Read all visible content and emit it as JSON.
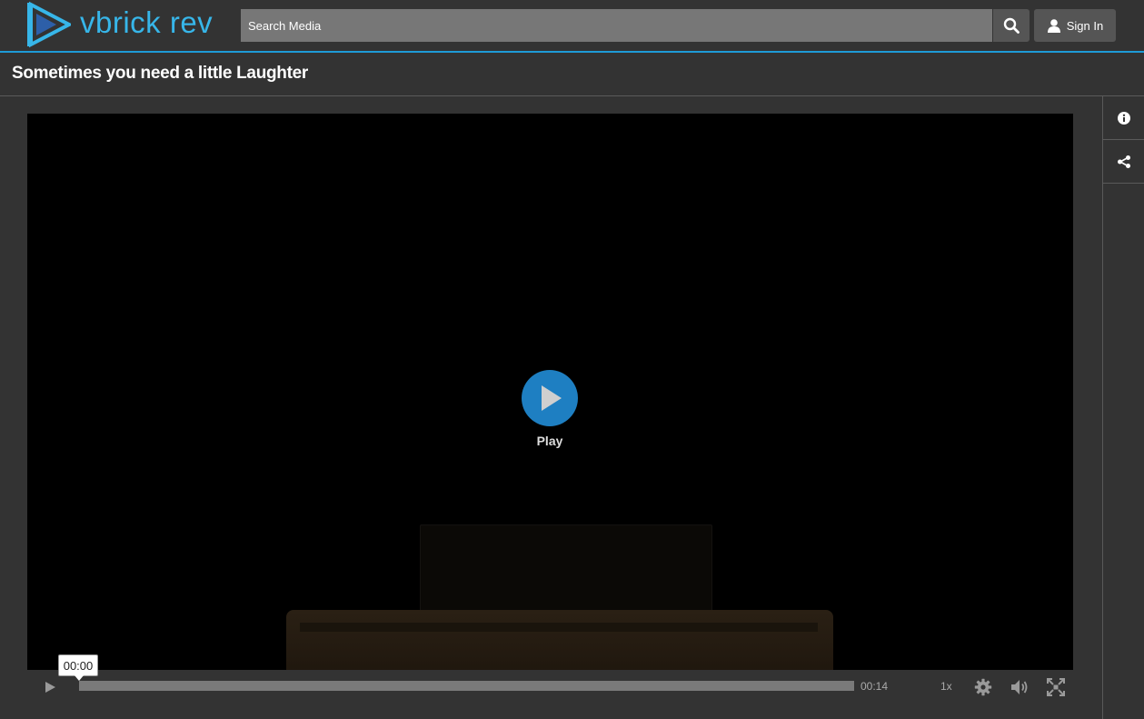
{
  "header": {
    "logo_text": "vbrick rev",
    "search_placeholder": "Search Media",
    "signin_label": "Sign In"
  },
  "page": {
    "title": "Sometimes you need a little Laughter"
  },
  "player": {
    "play_label": "Play",
    "current_time": "00:00",
    "duration": "00:14",
    "playback_speed": "1x",
    "progress_fraction": 0
  },
  "icons": {
    "logo": "play-triangle-logo-icon",
    "search": "search-icon",
    "user": "user-icon",
    "info": "info-icon",
    "share": "share-icon",
    "play": "play-icon",
    "settings": "gear-icon",
    "volume": "volume-icon",
    "fullscreen": "fullscreen-icon"
  },
  "colors": {
    "accent": "#1e9bd7",
    "logo": "#37b6e9",
    "play_button": "#1e7fc2",
    "background": "#333333"
  }
}
